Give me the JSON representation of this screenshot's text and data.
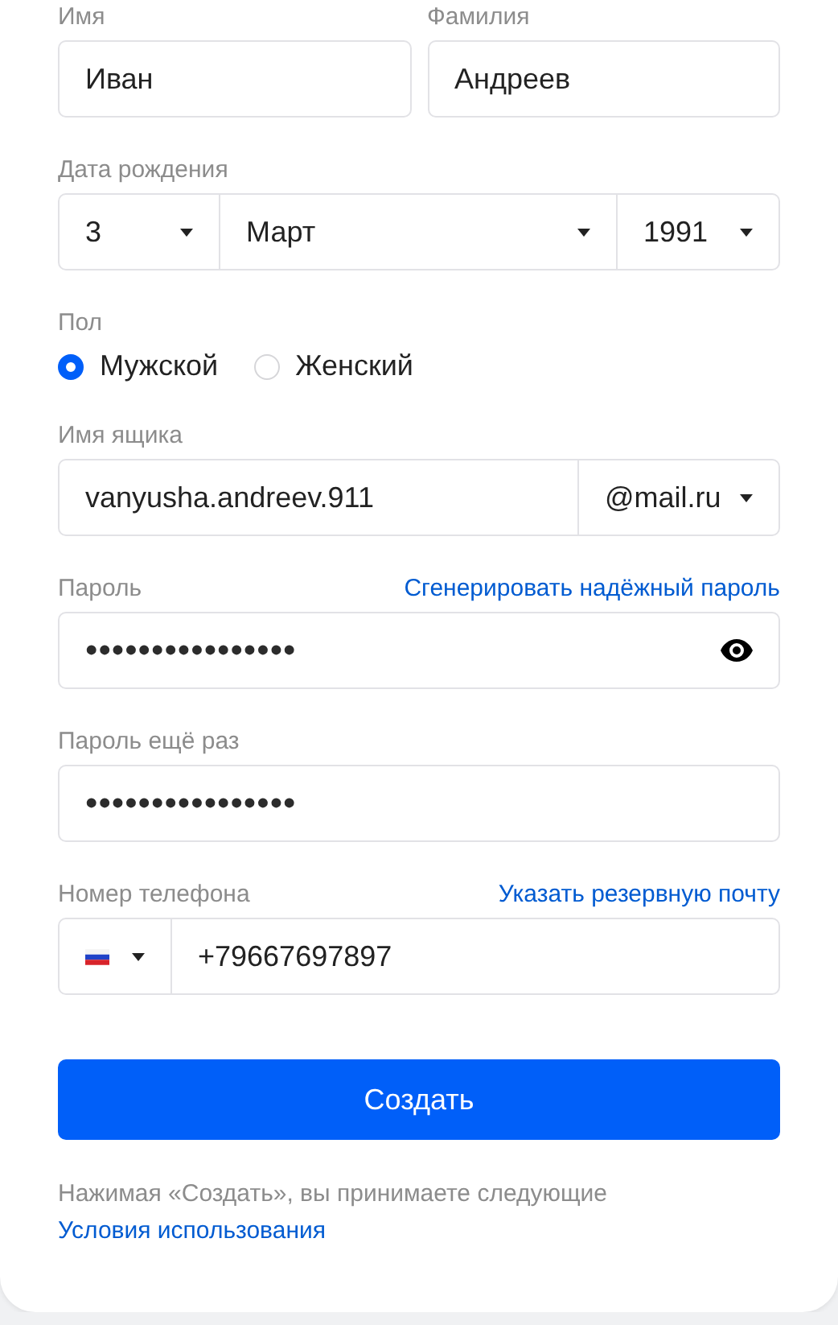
{
  "name_fields": [
    {
      "label": "Имя",
      "value": "Иван"
    },
    {
      "label": "Фамилия",
      "value": "Андреев"
    }
  ],
  "birth_date": {
    "label": "Дата рождения",
    "day": "3",
    "month": "Март",
    "year": "1991"
  },
  "gender": {
    "label": "Пол",
    "options": [
      {
        "label": "Мужской",
        "selected": true
      },
      {
        "label": "Женский",
        "selected": false
      }
    ]
  },
  "mailbox": {
    "label": "Имя ящика",
    "value": "vanyusha.andreev.911",
    "domain": "@mail.ru"
  },
  "password": {
    "label": "Пароль",
    "link": "Сгенерировать надёжный пароль",
    "value": "••••••••••••••••"
  },
  "password_repeat": {
    "label": "Пароль ещё раз",
    "value": "••••••••••••••••"
  },
  "phone": {
    "label": "Номер телефона",
    "link": "Указать резервную почту",
    "value": "+79667697897"
  },
  "submit": "Создать",
  "terms": {
    "text": "Нажимая «Создать», вы принимаете следующие ",
    "link": "Условия использования"
  }
}
